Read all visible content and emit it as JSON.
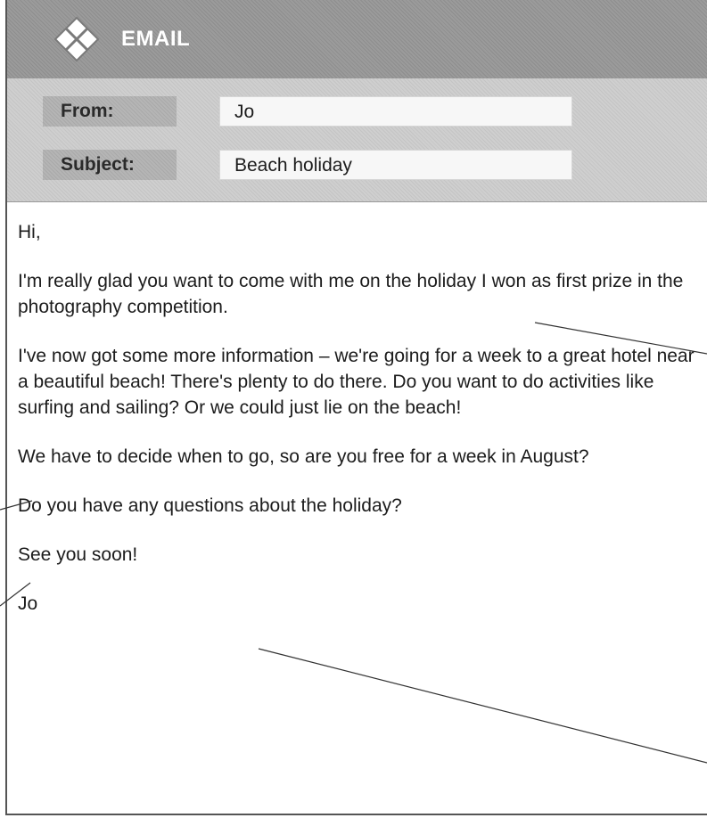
{
  "app": {
    "title": "EMAIL",
    "logo_icon": "envelope-diamond-icon"
  },
  "header": {
    "from_label": "From:",
    "from_value": "Jo",
    "subject_label": "Subject:",
    "subject_value": "Beach holiday"
  },
  "body": {
    "greeting": "Hi,",
    "paragraphs": [
      "I'm really glad you want to come with me on the holiday I won as first prize in the photography competition.",
      "I've now got some more information – we're going for a week to a great hotel near a beautiful beach! There's plenty to do there. Do you want to do activities like surfing and sailing? Or we could just lie on the beach!",
      "We have to decide when to go, so are you free for a week in August?",
      "Do you have any questions about the holiday?",
      "See you soon!"
    ],
    "signature": "Jo"
  },
  "colors": {
    "title_bar": "#959595",
    "header_area": "#cacaca",
    "label_box": "#afafaf",
    "value_box": "#f7f7f7"
  }
}
